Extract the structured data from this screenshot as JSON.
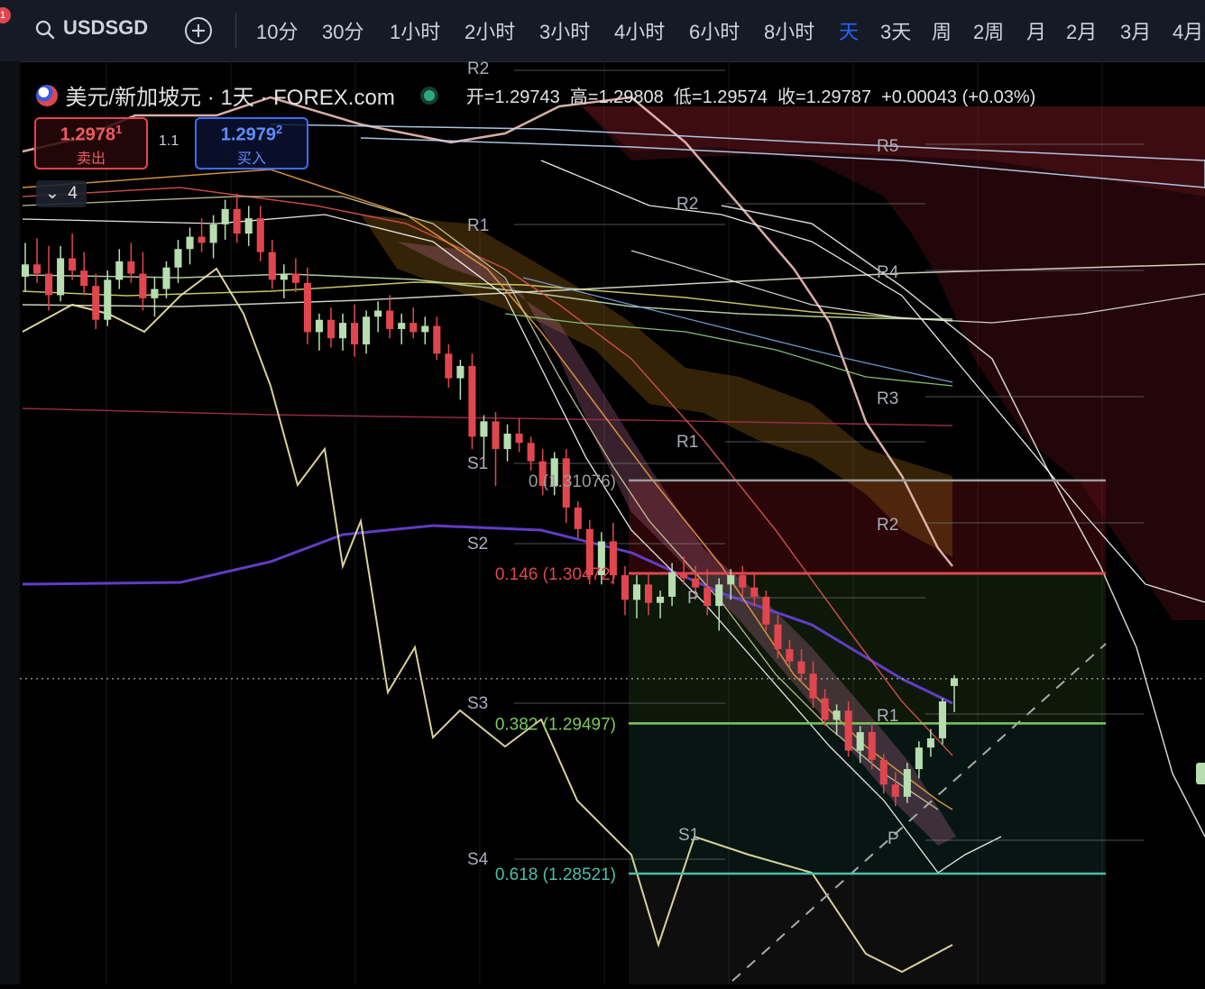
{
  "toolbar": {
    "symbol": "USDSGD",
    "notification_badge": "1",
    "add_icon": "plus-circle-icon",
    "search_icon": "search-icon",
    "intervals": [
      "10分",
      "30分",
      "1小时",
      "2小时",
      "3小时",
      "4小时",
      "6小时",
      "8小时",
      "天",
      "3天",
      "周",
      "2周",
      "月",
      "2月",
      "3月",
      "4月"
    ],
    "active_interval": "天"
  },
  "legend": {
    "title": "美元/新加坡元 · 1天 · FOREX.com",
    "ohlc": "开=1.29743  高=1.29808  低=1.29574  收=1.29787  +0.00043 (+0.03%)",
    "sell_price_main": "1.2978",
    "sell_price_sup": "1",
    "sell_label": "卖出",
    "spread": "1.1",
    "buy_price_main": "1.2979",
    "buy_price_sup": "2",
    "buy_label": "买入",
    "indicator_count": "4"
  },
  "colors": {
    "up": "#b7ddb0",
    "down": "#e0464e",
    "accent": "#2962ff",
    "fib_0": "#9a9a9a",
    "fib_0146": "#e0464e",
    "fib_0382": "#7cc95f",
    "fib_0618": "#4dbfa8"
  },
  "chart_data": {
    "type": "candlestick",
    "symbol": "USDSGD",
    "timeframe": "1D",
    "y_range": [
      1.278,
      1.338
    ],
    "last_price": 1.29787,
    "candles": [
      [
        1.324,
        1.3262,
        1.323,
        1.3248
      ],
      [
        1.3248,
        1.3265,
        1.3236,
        1.3242
      ],
      [
        1.3242,
        1.326,
        1.3218,
        1.3228
      ],
      [
        1.3228,
        1.326,
        1.3224,
        1.3252
      ],
      [
        1.3252,
        1.3268,
        1.3238,
        1.3244
      ],
      [
        1.3244,
        1.3256,
        1.3228,
        1.3234
      ],
      [
        1.3234,
        1.3242,
        1.3206,
        1.3212
      ],
      [
        1.3212,
        1.3244,
        1.3208,
        1.3238
      ],
      [
        1.3238,
        1.3258,
        1.3232,
        1.325
      ],
      [
        1.325,
        1.3262,
        1.3236,
        1.3242
      ],
      [
        1.3242,
        1.3256,
        1.3218,
        1.3226
      ],
      [
        1.3226,
        1.324,
        1.3214,
        1.3232
      ],
      [
        1.3232,
        1.325,
        1.3226,
        1.3246
      ],
      [
        1.3246,
        1.3264,
        1.3236,
        1.3258
      ],
      [
        1.3258,
        1.3272,
        1.3248,
        1.3266
      ],
      [
        1.3266,
        1.3278,
        1.3256,
        1.3262
      ],
      [
        1.3262,
        1.328,
        1.3252,
        1.3274
      ],
      [
        1.3274,
        1.329,
        1.3264,
        1.3284
      ],
      [
        1.3284,
        1.3294,
        1.3262,
        1.3268
      ],
      [
        1.3268,
        1.3286,
        1.326,
        1.3278
      ],
      [
        1.3278,
        1.3286,
        1.325,
        1.3256
      ],
      [
        1.3256,
        1.3264,
        1.3232,
        1.3238
      ],
      [
        1.3238,
        1.3248,
        1.3226,
        1.3242
      ],
      [
        1.3242,
        1.3252,
        1.323,
        1.3236
      ],
      [
        1.3236,
        1.3246,
        1.3196,
        1.3204
      ],
      [
        1.3204,
        1.3216,
        1.3192,
        1.3212
      ],
      [
        1.3212,
        1.322,
        1.3194,
        1.32
      ],
      [
        1.32,
        1.3216,
        1.3192,
        1.321
      ],
      [
        1.321,
        1.3222,
        1.3188,
        1.3196
      ],
      [
        1.3196,
        1.3218,
        1.319,
        1.3214
      ],
      [
        1.3214,
        1.3224,
        1.3204,
        1.3218
      ],
      [
        1.3218,
        1.3228,
        1.32,
        1.3206
      ],
      [
        1.3206,
        1.3216,
        1.3196,
        1.321
      ],
      [
        1.321,
        1.322,
        1.32,
        1.3204
      ],
      [
        1.3204,
        1.3214,
        1.3196,
        1.3208
      ],
      [
        1.3208,
        1.3214,
        1.3186,
        1.319
      ],
      [
        1.319,
        1.3196,
        1.3168,
        1.3174
      ],
      [
        1.3174,
        1.3186,
        1.316,
        1.3182
      ],
      [
        1.3182,
        1.319,
        1.3128,
        1.3136
      ],
      [
        1.3136,
        1.315,
        1.312,
        1.3146
      ],
      [
        1.3146,
        1.3152,
        1.3104,
        1.3128
      ],
      [
        1.3128,
        1.3144,
        1.312,
        1.3138
      ],
      [
        1.3138,
        1.3148,
        1.3126,
        1.3132
      ],
      [
        1.3132,
        1.3136,
        1.3114,
        1.312
      ],
      [
        1.312,
        1.3128,
        1.3098,
        1.3104
      ],
      [
        1.3104,
        1.3126,
        1.3098,
        1.3122
      ],
      [
        1.3122,
        1.3128,
        1.308,
        1.309
      ],
      [
        1.309,
        1.3094,
        1.307,
        1.3076
      ],
      [
        1.3076,
        1.3082,
        1.304,
        1.3046
      ],
      [
        1.3046,
        1.3074,
        1.304,
        1.3068
      ],
      [
        1.3068,
        1.308,
        1.304,
        1.3046
      ],
      [
        1.3046,
        1.3052,
        1.302,
        1.303
      ],
      [
        1.303,
        1.3046,
        1.3018,
        1.304
      ],
      [
        1.304,
        1.3048,
        1.302,
        1.3028
      ],
      [
        1.3028,
        1.3036,
        1.3018,
        1.3032
      ],
      [
        1.3032,
        1.3054,
        1.3026,
        1.3048
      ],
      [
        1.3048,
        1.3058,
        1.304,
        1.3044
      ],
      [
        1.3044,
        1.3052,
        1.303,
        1.3038
      ],
      [
        1.3038,
        1.305,
        1.302,
        1.3026
      ],
      [
        1.3026,
        1.3044,
        1.301,
        1.304
      ],
      [
        1.304,
        1.305,
        1.303,
        1.3046
      ],
      [
        1.3046,
        1.3052,
        1.3032,
        1.3038
      ],
      [
        1.3038,
        1.3048,
        1.3026,
        1.3032
      ],
      [
        1.3032,
        1.3036,
        1.301,
        1.3014
      ],
      [
        1.3014,
        1.302,
        1.2992,
        1.2998
      ],
      [
        1.2998,
        1.3004,
        1.2986,
        1.299
      ],
      [
        1.299,
        1.2998,
        1.2976,
        1.2982
      ],
      [
        1.2982,
        1.299,
        1.296,
        1.2966
      ],
      [
        1.2966,
        1.2972,
        1.2948,
        1.2952
      ],
      [
        1.2952,
        1.2962,
        1.2942,
        1.2958
      ],
      [
        1.2958,
        1.2964,
        1.2928,
        1.2932
      ],
      [
        1.2932,
        1.2948,
        1.2924,
        1.2944
      ],
      [
        1.2944,
        1.295,
        1.292,
        1.2926
      ],
      [
        1.2926,
        1.293,
        1.2904,
        1.291
      ],
      [
        1.291,
        1.2918,
        1.2896,
        1.2902
      ],
      [
        1.2902,
        1.2924,
        1.2898,
        1.292
      ],
      [
        1.292,
        1.2938,
        1.2914,
        1.2934
      ],
      [
        1.2934,
        1.2946,
        1.2928,
        1.294
      ],
      [
        1.294,
        1.2966,
        1.2936,
        1.2964
      ],
      [
        1.2974,
        1.2981,
        1.2957,
        1.2979
      ]
    ],
    "fibonacci": [
      {
        "label": "0 (1.31076)",
        "value": 1.31076
      },
      {
        "label": "0.146 (1.30472)",
        "value": 1.30472
      },
      {
        "label": "0.382 (1.29497)",
        "value": 1.29497
      },
      {
        "label": "0.618 (1.28521)",
        "value": 1.28521
      }
    ],
    "pivot_labels": [
      "R2",
      "R1",
      "S1",
      "S2",
      "S3",
      "S4",
      "P",
      "R5",
      "R4",
      "R3",
      "R2",
      "R1",
      "P",
      "S1"
    ]
  }
}
